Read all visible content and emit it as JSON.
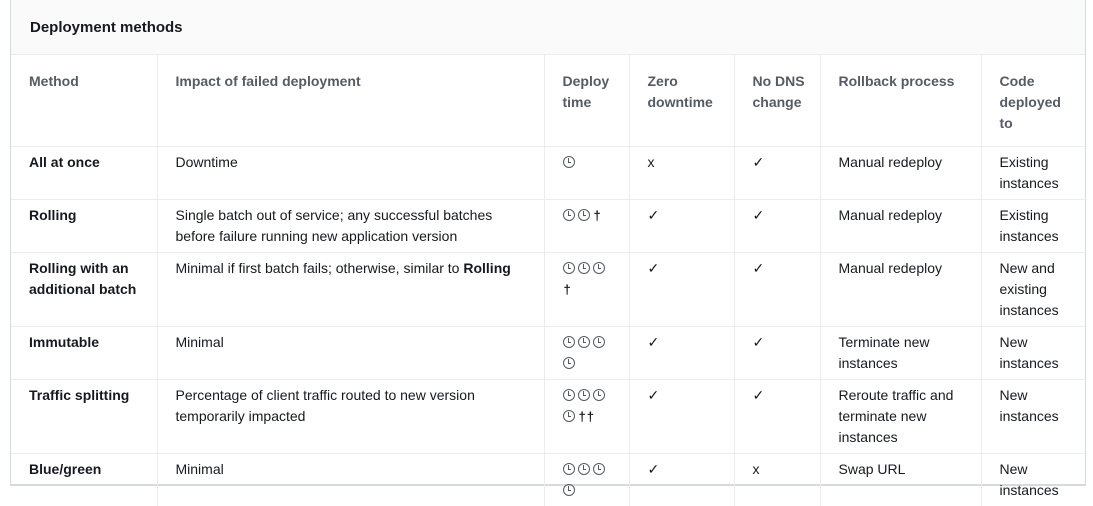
{
  "panel": {
    "title": "Deployment methods"
  },
  "headers": {
    "method": "Method",
    "impact": "Impact of failed deployment",
    "deploy_time": "Deploy time",
    "zero_downtime": "Zero downtime",
    "no_dns": "No DNS change",
    "rollback": "Rollback process",
    "code_to": "Code deployed to"
  },
  "rows": [
    {
      "method": "All at once",
      "impact": "Downtime",
      "impact_bold": "",
      "clocks": 1,
      "dagger": "",
      "zero": "x",
      "dns": "✓",
      "rollback": "Manual redeploy",
      "code": "Existing instances"
    },
    {
      "method": "Rolling",
      "impact": "Single batch out of service; any successful batches before failure running new application version",
      "impact_bold": "",
      "clocks": 2,
      "dagger": "†",
      "zero": "✓",
      "dns": "✓",
      "rollback": "Manual redeploy",
      "code": "Existing instances"
    },
    {
      "method": "Rolling with an additional batch",
      "impact": "Minimal if first batch fails; otherwise, similar to",
      "impact_bold": "Rolling",
      "clocks": 3,
      "dagger": "†",
      "zero": "✓",
      "dns": "✓",
      "rollback": "Manual redeploy",
      "code": "New and existing instances"
    },
    {
      "method": "Immutable",
      "impact": "Minimal",
      "impact_bold": "",
      "clocks": 4,
      "dagger": "",
      "zero": "✓",
      "dns": "✓",
      "rollback": "Terminate new instances",
      "code": "New instances"
    },
    {
      "method": "Traffic splitting",
      "impact": "Percentage of client traffic routed to new version temporarily impacted",
      "impact_bold": "",
      "clocks": 4,
      "dagger": "††",
      "zero": "✓",
      "dns": "✓",
      "rollback": "Reroute traffic and terminate new instances",
      "code": "New instances"
    },
    {
      "method": "Blue/green",
      "impact": "Minimal",
      "impact_bold": "",
      "clocks": 4,
      "dagger": "",
      "zero": "✓",
      "dns": "x",
      "rollback": "Swap URL",
      "code": "New instances"
    }
  ]
}
